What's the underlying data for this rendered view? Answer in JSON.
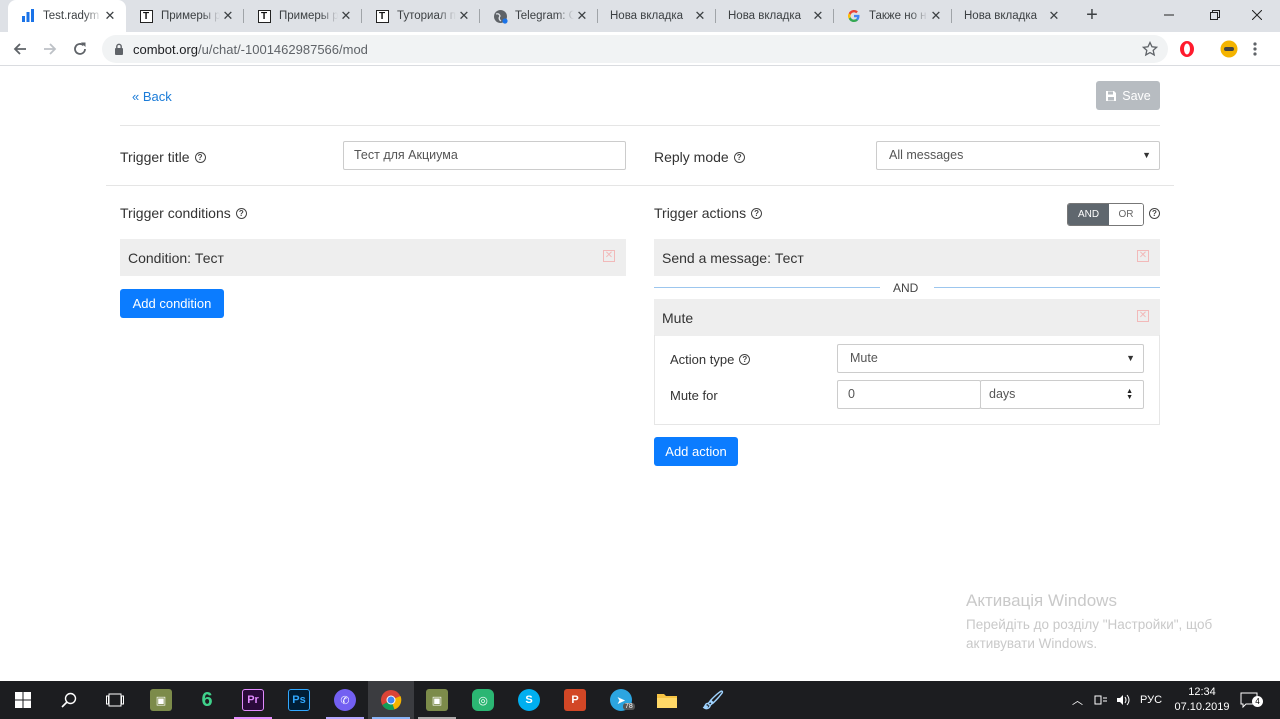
{
  "browser": {
    "tabs": [
      {
        "title": "Test.radym",
        "active": true
      },
      {
        "title": "Примеры р"
      },
      {
        "title": "Примеры р"
      },
      {
        "title": "Туториал п"
      },
      {
        "title": "Telegram: C"
      },
      {
        "title": "Нова вкладка"
      },
      {
        "title": "Нова вкладка"
      },
      {
        "title": "Также но н"
      },
      {
        "title": "Нова вкладка"
      }
    ],
    "url_host": "combot.org",
    "url_path": "/u/chat/-1001462987566/mod"
  },
  "page": {
    "back_label": "Back",
    "save_label": "Save",
    "trigger_title_label": "Trigger title",
    "trigger_title_value": "Тест для Акциума",
    "reply_mode_label": "Reply mode",
    "reply_mode_value": "All messages",
    "trigger_conditions_label": "Trigger conditions",
    "condition_item": "Condition: Тест",
    "add_condition_label": "Add condition",
    "trigger_actions_label": "Trigger actions",
    "toggle_and": "AND",
    "toggle_or": "OR",
    "action_send": "Send a message: Тест",
    "and_separator": "AND",
    "action_mute": "Mute",
    "action_type_label": "Action type",
    "action_type_value": "Mute",
    "mute_for_label": "Mute for",
    "mute_for_value": "0",
    "mute_unit_value": "days",
    "add_action_label": "Add action"
  },
  "watermark": {
    "title": "Активація Windows",
    "line1": "Перейдіть до розділу \"Настройки\", щоб",
    "line2": "активувати Windows."
  },
  "taskbar": {
    "lang": "РУС",
    "time": "12:34",
    "date": "07.10.2019",
    "notifications": "4",
    "telegram_badge": "78"
  }
}
